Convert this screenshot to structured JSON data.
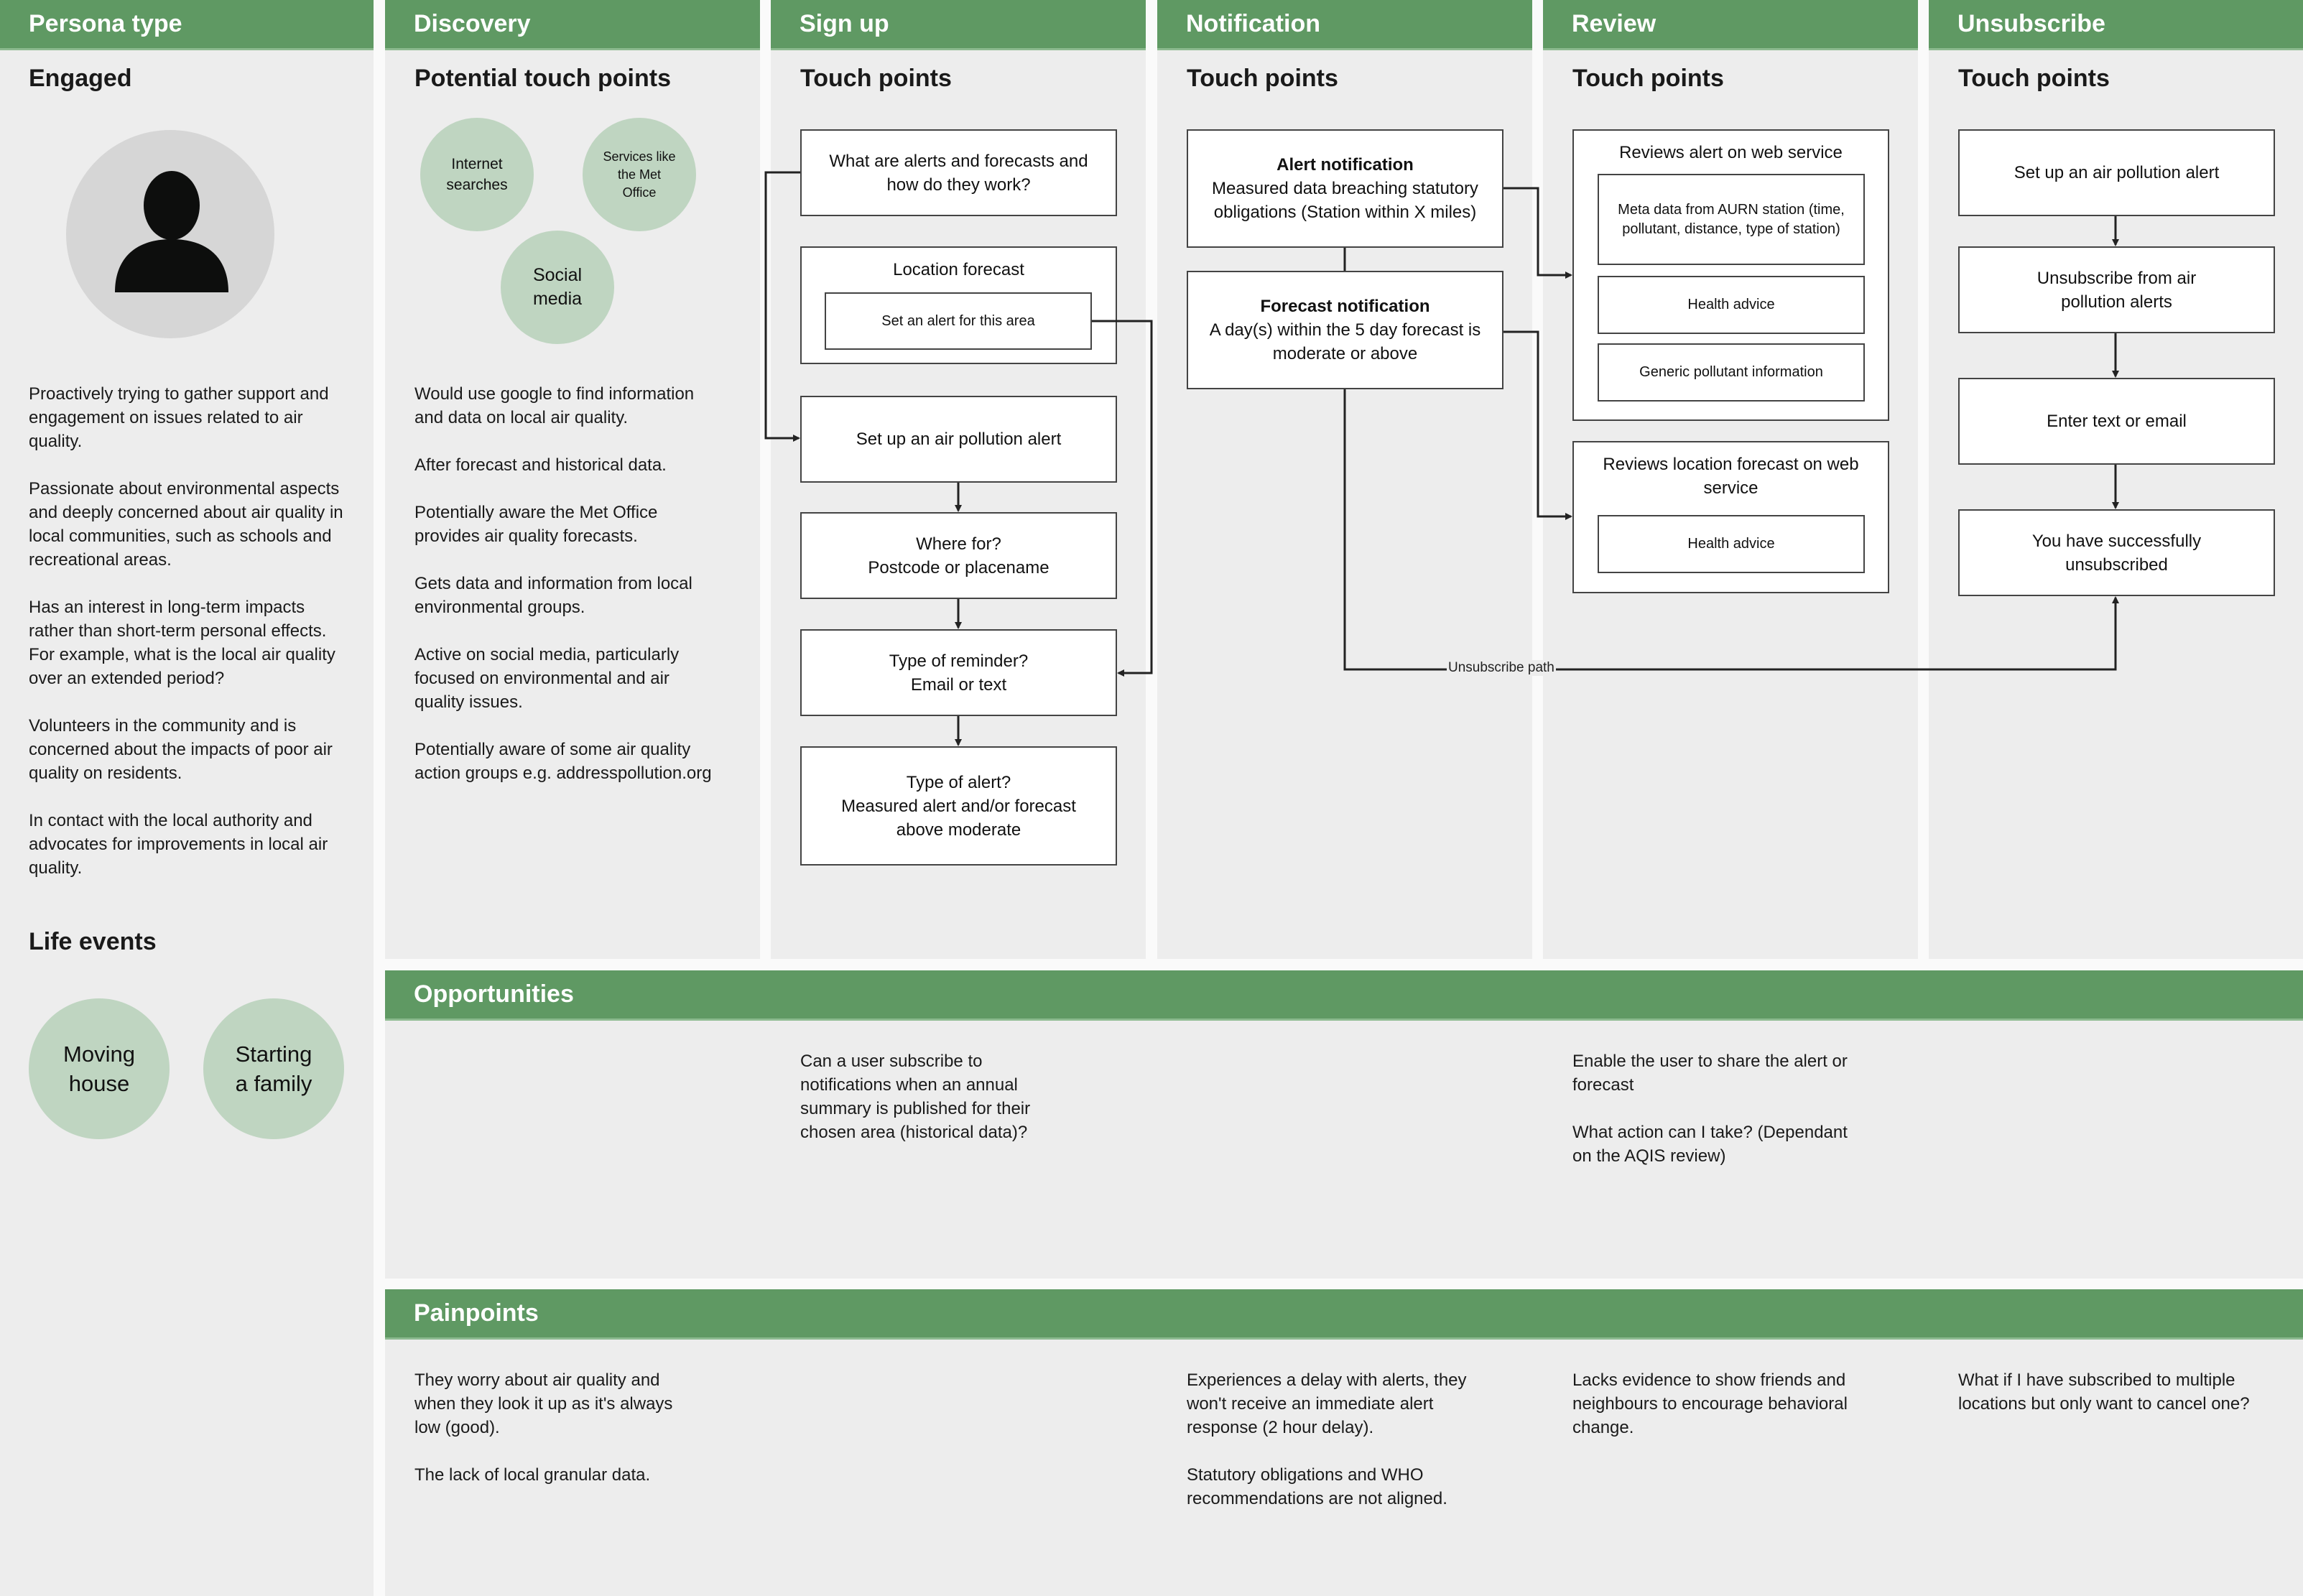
{
  "colors": {
    "header_green": "#5f9963",
    "panel_grey": "#ededed",
    "circle_green": "#bfd5c1",
    "avatar_grey": "#d6d6d6"
  },
  "columns": [
    {
      "title": "Persona type"
    },
    {
      "title": "Discovery"
    },
    {
      "title": "Sign up"
    },
    {
      "title": "Notification"
    },
    {
      "title": "Review"
    },
    {
      "title": "Unsubscribe"
    }
  ],
  "persona": {
    "type": "Engaged",
    "avatar_icon": "user-silhouette-icon",
    "description": [
      "Proactively trying to gather support and engagement on issues related to air quality.",
      "Passionate about environmental aspects and deeply concerned about air quality in local communities, such as schools and recreational areas.",
      "Has an interest in long-term impacts rather than short-term personal effects. For example, what is the local air quality over an extended period?",
      "Volunteers in the community and is concerned about the impacts of poor air quality on residents.",
      "In contact with the local authority and advocates for improvements in local air quality."
    ],
    "life_events_title": "Life events",
    "life_events": [
      "Moving house",
      "Starting a family"
    ]
  },
  "discovery": {
    "subtitle": "Potential touch points",
    "touch_points": [
      "Internet searches",
      "Services like the Met Office",
      "Social media"
    ],
    "notes": [
      "Would use google to find information and data on local air quality.",
      "After forecast and historical data.",
      "Potentially aware the Met Office provides air quality forecasts.",
      "Gets data and information from local environmental groups.",
      "Active on social media, particularly focused on environmental and air quality issues.",
      "Potentially aware of some air quality action groups e.g. addresspollution.org"
    ]
  },
  "signup": {
    "subtitle": "Touch points",
    "what_are_alerts": "What are alerts and forecasts and how do they work?",
    "location_forecast": "Location forecast",
    "set_alert_area": "Set an alert for this area",
    "setup_alert": "Set up an air pollution alert",
    "where_for_title": "Where for?",
    "where_for_detail": "Postcode or placename",
    "reminder_title": "Type of reminder?",
    "reminder_detail": "Email or text",
    "alert_type_title": "Type of alert?",
    "alert_type_detail": "Measured alert and/or forecast above moderate"
  },
  "notification": {
    "subtitle": "Touch points",
    "alert_title": "Alert notification",
    "alert_detail": "Measured data breaching statutory obligations (Station within X miles)",
    "forecast_title": "Forecast notification",
    "forecast_detail": "A day(s) within the 5 day forecast is moderate or above",
    "unsubscribe_path_label": "Unsubscribe path"
  },
  "review": {
    "subtitle": "Touch points",
    "alert_review_title": "Reviews alert on web service",
    "alert_review_items": [
      "Meta data from AURN station (time, pollutant, distance, type of station)",
      "Health advice",
      "Generic pollutant information"
    ],
    "forecast_review_title": "Reviews location forecast on web service",
    "forecast_review_items": [
      "Health advice"
    ]
  },
  "unsubscribe": {
    "subtitle": "Touch points",
    "steps": [
      "Set up an air pollution alert",
      "Unsubscribe from air pollution alerts",
      "Enter text or email",
      "You have successfully unsubscribed"
    ]
  },
  "opportunities": {
    "title": "Opportunities",
    "signup": "Can a user subscribe to notifications when an annual summary is published for their chosen area (historical data)?",
    "review": [
      "Enable the user to share the alert or forecast",
      "What action can I take? (Dependant on the AQIS review)"
    ]
  },
  "painpoints": {
    "title": "Painpoints",
    "discovery": [
      "They worry about air quality and when they look it up as it's always low (good).",
      "The lack of local granular data."
    ],
    "notification": [
      "Experiences a delay with alerts, they won't receive an immediate alert response (2 hour delay).",
      "Statutory obligations and WHO recommendations are not aligned."
    ],
    "review": [
      "Lacks evidence to show friends and neighbours to encourage behavioral change."
    ],
    "unsubscribe": [
      "What if I have subscribed to multiple locations but only want to cancel one?"
    ]
  }
}
